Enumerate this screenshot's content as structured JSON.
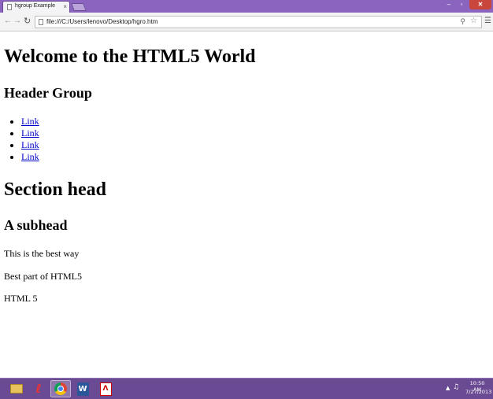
{
  "browser": {
    "tab_title": "hgroup Example",
    "tab_close": "×",
    "url": "file:///C:/Users/lenovo/Desktop/hgro.htm",
    "minimize": "–",
    "maximize": "▫",
    "close": "✕"
  },
  "page": {
    "title": "Welcome to the HTML5 World",
    "hgroup_subtitle": "Header Group",
    "links": [
      "Link",
      "Link",
      "Link",
      "Link"
    ],
    "section_head": "Section head",
    "subhead": "A subhead",
    "paragraphs": [
      "This is the best way",
      "Best part of HTML5",
      "HTML 5"
    ]
  },
  "taskbar": {
    "apps": [
      "file-explorer-icon",
      "fl-studio-icon",
      "chrome-icon",
      "word-icon",
      "acrobat-icon"
    ],
    "time": "10:50 AM",
    "date": "7/27/2013"
  },
  "colors": {
    "titlebar": "#8b64c0",
    "taskbar": "#6a4a92",
    "link": "#0000cc",
    "close_button": "#c9463d"
  }
}
